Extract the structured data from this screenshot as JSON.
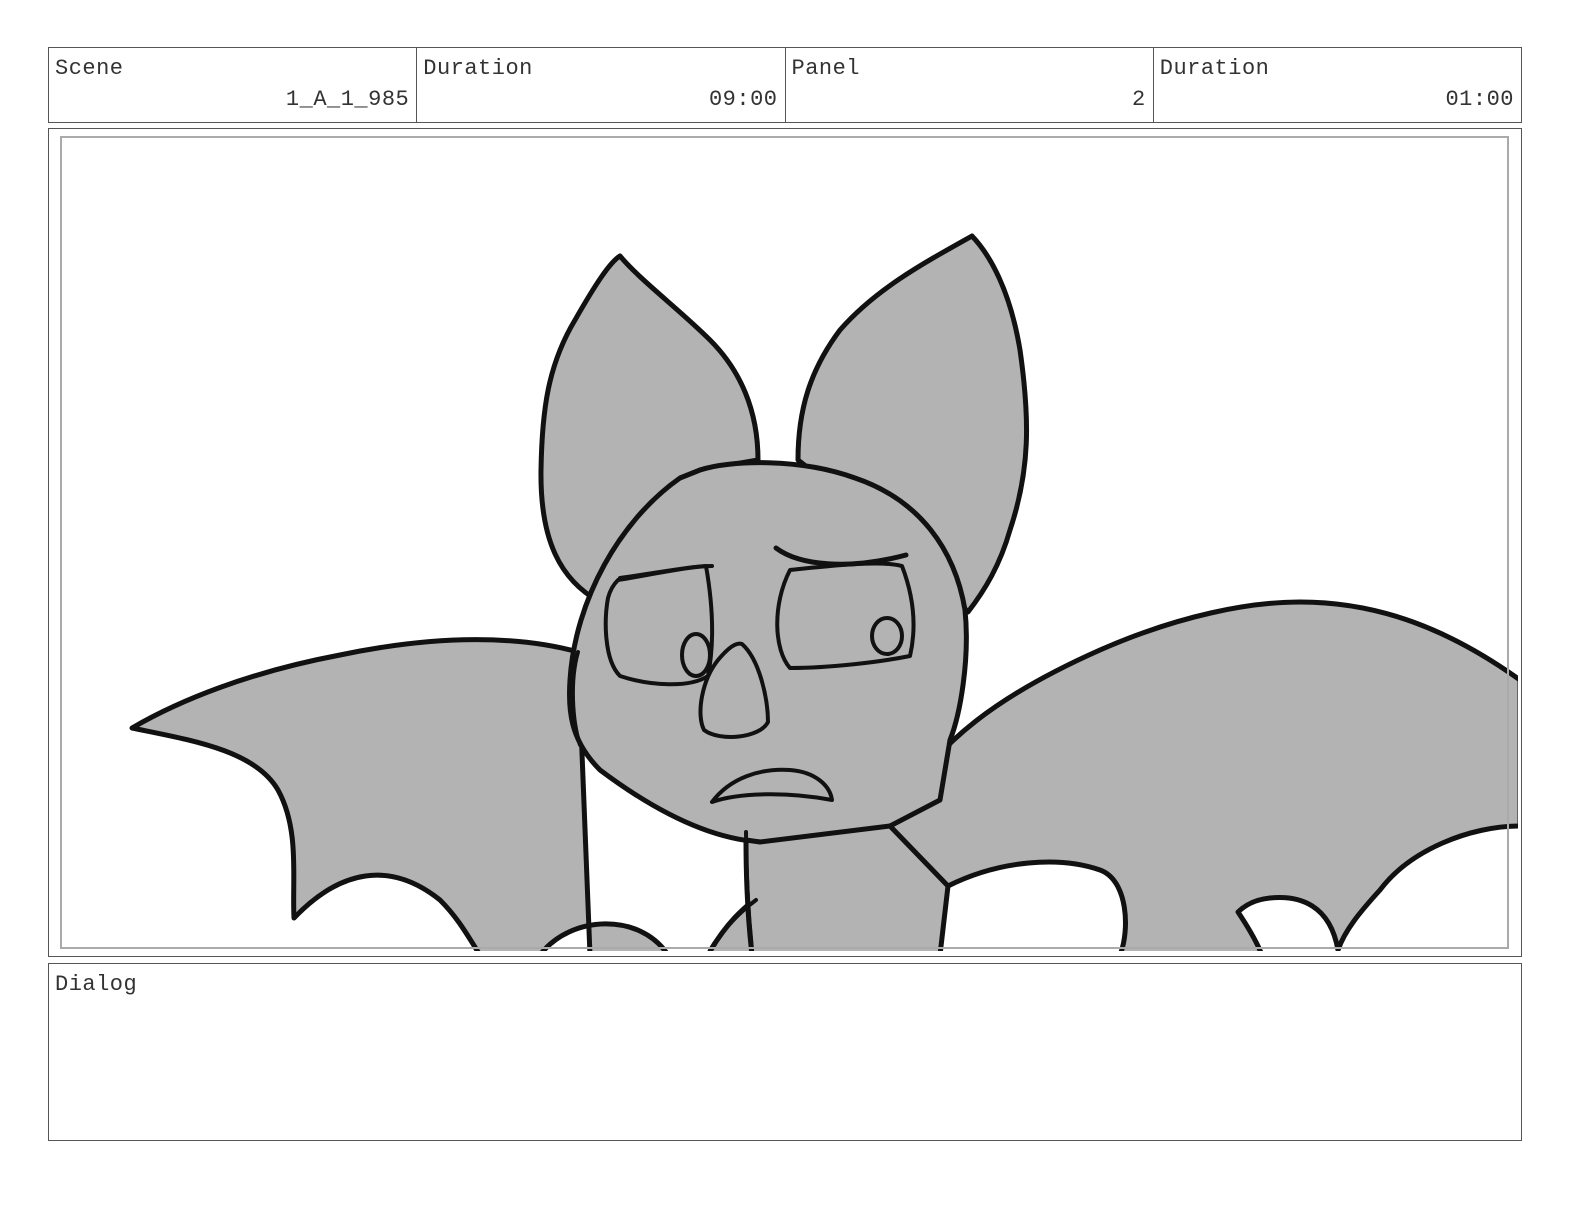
{
  "header": {
    "scene_label": "Scene",
    "scene_value": "1_A_1_985",
    "scene_duration_label": "Duration",
    "scene_duration_value": "09:00",
    "panel_label": "Panel",
    "panel_value": "2",
    "panel_duration_label": "Duration",
    "panel_duration_value": "01:00"
  },
  "dialog": {
    "label": "Dialog",
    "text": ""
  },
  "colors": {
    "fill": "#b3b3b3",
    "stroke": "#111111",
    "frame": "#555555"
  }
}
